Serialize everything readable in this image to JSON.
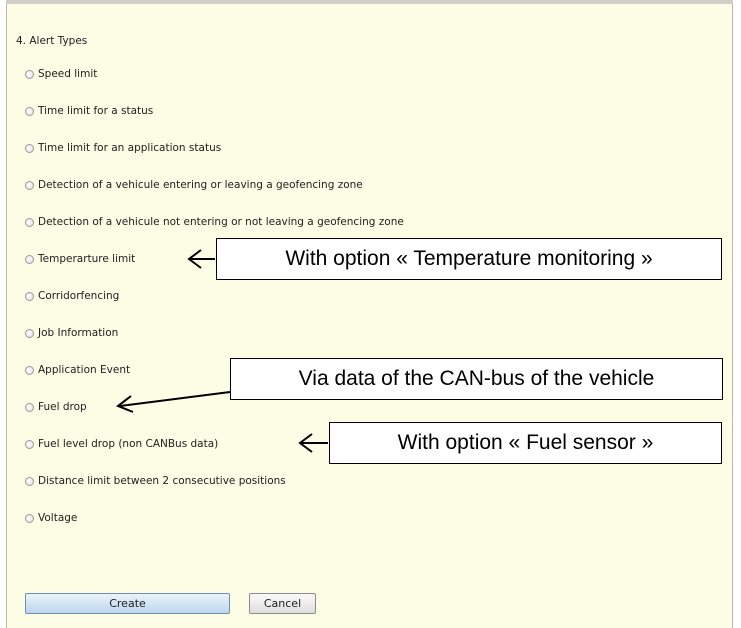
{
  "form": {
    "section_title": "4. Alert Types",
    "options": [
      "Speed limit",
      "Time limit for a status",
      "Time limit for an application status",
      "Detection of a vehicule entering or leaving a geofencing zone",
      "Detection of a vehicule not entering or not leaving a geofencing zone",
      "Temperarture limit",
      "Corridorfencing",
      "Job Information",
      "Application Event",
      "Fuel drop",
      "Fuel level drop (non CANBus data)",
      "Distance limit between 2 consecutive positions",
      "Voltage"
    ],
    "create_label": "Create",
    "cancel_label": "Cancel"
  },
  "callouts": {
    "temperature": "With option « Temperature monitoring »",
    "canbus": "Via data of the CAN-bus of the vehicle",
    "fuel_sensor": "With option « Fuel sensor »"
  },
  "colors": {
    "panel_background": "#fdfde6",
    "create_button": "#bcd6ee"
  }
}
